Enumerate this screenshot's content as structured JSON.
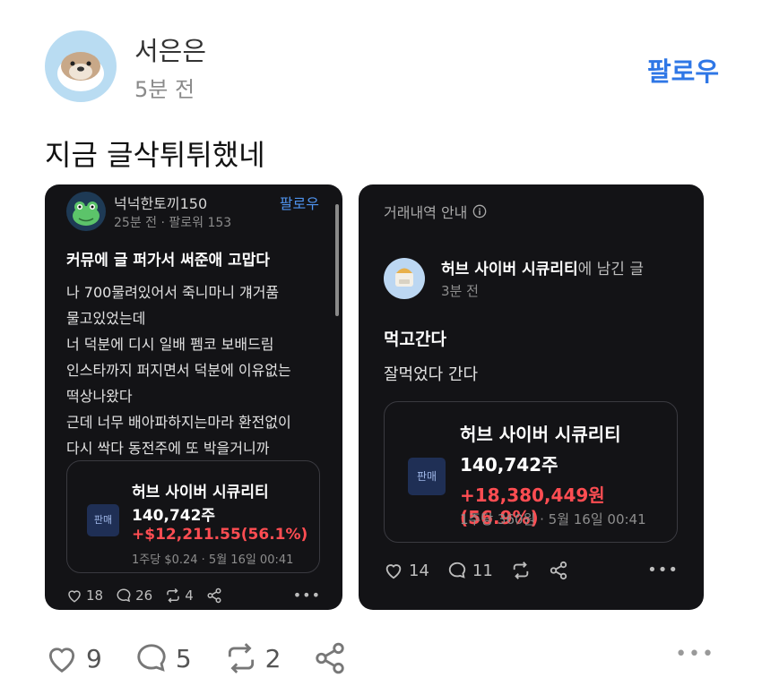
{
  "post": {
    "author": "서은은",
    "time": "5분 전",
    "follow_label": "팔로우",
    "text": "지금 글삭튀튀했네",
    "likes": "9",
    "comments": "5",
    "reposts": "2"
  },
  "left_card": {
    "author": "넉넉한토끼150",
    "meta": "25분 전 · 팔로워 153",
    "follow_label": "팔로우",
    "title": "커뮤에 글 퍼가서 써준애 고맙다",
    "body_lines": [
      "나 700물려있어서 죽니마니 걔거품",
      "물고있었는데",
      "너 덕분에 디시 일배 펨코 보배드림",
      "인스타까지 퍼지면서 덕분에 이유없는",
      "떡상나왔다",
      "근데 너무 배아파하지는마라 환전없이",
      "다시 싹다 동전주에 또 박을거니까"
    ],
    "stock": {
      "badge": "판매",
      "name": "허브 사이버 시큐리티",
      "qty": "140,742주",
      "profit": "+$12,211.55(56.1%)",
      "sub": "1주당 $0.24 · 5월 16일 00:41"
    },
    "likes": "18",
    "comments": "26",
    "reposts": "4"
  },
  "right_card": {
    "header": "거래내역 안내",
    "author_name": "허브 사이버 시큐리티",
    "author_suffix": "에 남긴 글",
    "time": "3분 전",
    "title": "먹고간다",
    "body": "잘먹었다 간다",
    "stock": {
      "badge": "판매",
      "name": "허브 사이버 시큐리티",
      "qty": "140,742주",
      "profit": "+18,380,449원(56.9%)",
      "sub": "1주당 360원 · 5월 16일 00:41"
    },
    "likes": "14",
    "comments": "11"
  },
  "colors": {
    "accent": "#2f77e6",
    "card_bg": "#131316",
    "profit_red": "#ff4d52"
  },
  "icons": [
    "heart-icon",
    "comment-icon",
    "repost-icon",
    "share-icon",
    "more-icon",
    "info-icon"
  ]
}
